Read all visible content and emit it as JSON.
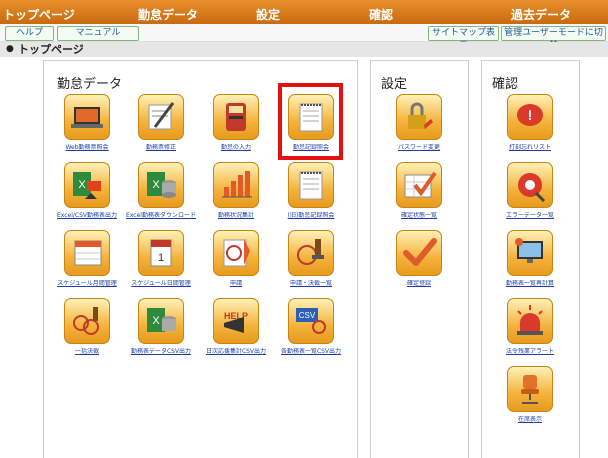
{
  "menubar": {
    "items": [
      "トップページ",
      "勤怠データ",
      "設定",
      "確認",
      "過去データ"
    ]
  },
  "toolbar": {
    "help": "ヘルプ",
    "manual": "マニュアル",
    "sitemap": "サイトマップ表示",
    "admin_user_mode": "管理ユーザーモードに切替"
  },
  "breadcrumb": "トップページ",
  "panels": {
    "kintai": {
      "title": "勤怠データ",
      "tiles": [
        {
          "label": "Web勤務票照会",
          "icon": "laptop-icon"
        },
        {
          "label": "勤務票修正",
          "icon": "pen-form-icon"
        },
        {
          "label": "勤怠の入力",
          "icon": "timecard-machine-icon"
        },
        {
          "label": "勤怠記録照会",
          "icon": "notepad-icon"
        },
        {
          "label": "Excel/CSV勤務表出力",
          "icon": "excel-export-icon"
        },
        {
          "label": "Excel勤務表ダウンロード",
          "icon": "excel-download-icon"
        },
        {
          "label": "勤務状況集計",
          "icon": "bar-chart-icon"
        },
        {
          "label": "(旧)勤怠記録照会",
          "icon": "notepad-old-icon"
        },
        {
          "label": "スケジュール月間管理",
          "icon": "calendar-icon"
        },
        {
          "label": "スケジュール日間管理",
          "icon": "daily-calendar-icon"
        },
        {
          "label": "申請",
          "icon": "stamp-request-icon"
        },
        {
          "label": "申請・決裁一覧",
          "icon": "stamp-list-icon"
        },
        {
          "label": "一括決裁",
          "icon": "bulk-stamp-icon"
        },
        {
          "label": "勤務表データCSV出力",
          "icon": "csv-db-icon"
        },
        {
          "label": "日次応援集計CSV出力",
          "icon": "help-megaphone-icon"
        },
        {
          "label": "各勤務表一覧CSV出力",
          "icon": "csv-list-icon"
        }
      ]
    },
    "settings": {
      "title": "設定",
      "tiles": [
        {
          "label": "パスワード変更",
          "icon": "padlock-icon"
        },
        {
          "label": "確定状態一覧",
          "icon": "checked-grid-icon"
        },
        {
          "label": "確定登録",
          "icon": "checkmark-icon"
        }
      ]
    },
    "confirm": {
      "title": "確認",
      "tiles": [
        {
          "label": "打刻忘れリスト",
          "icon": "alert-bubble-icon"
        },
        {
          "label": "エラーデータ一覧",
          "icon": "error-gear-icon"
        },
        {
          "label": "勤務表一覧再計算",
          "icon": "monitor-icon"
        },
        {
          "label": "法令残業アラート",
          "icon": "siren-icon"
        },
        {
          "label": "在席表示",
          "icon": "office-chair-icon"
        }
      ]
    }
  },
  "colors": {
    "menubar": "#d9761a",
    "tile_fill": "#f4b33c",
    "link": "#1e3ea8",
    "highlight": "#e51010"
  }
}
